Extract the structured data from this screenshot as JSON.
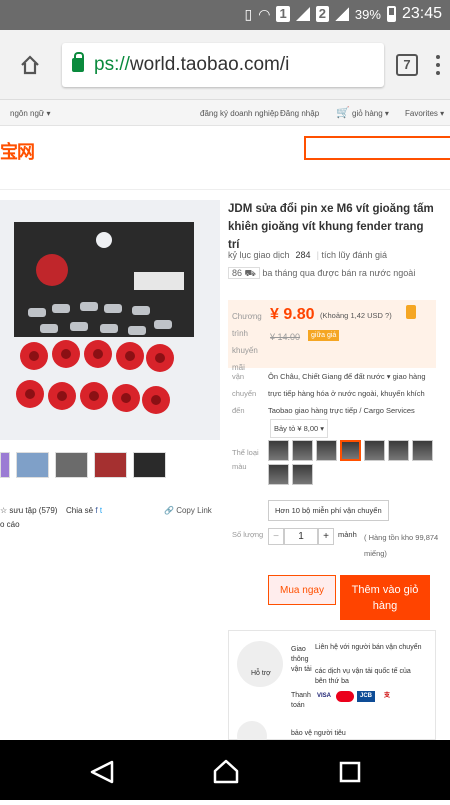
{
  "status": {
    "sim1": "1",
    "sim2": "2",
    "battery": "39%",
    "time": "23:45"
  },
  "browser": {
    "url_prefix": "ps://",
    "url_rest": "world.taobao.com/i",
    "tab_count": "7"
  },
  "topnav": {
    "language": "ngôn ngữ ▾",
    "business_signup": "đăng ký doanh nghiệp",
    "login": "Đăng nhập",
    "cart": "giỏ hàng ▾",
    "favorites": "Favorites ▾"
  },
  "logo": "宝网",
  "product": {
    "title": "JDM sửa đổi pin xe M6 vít gioăng tấm khiên gioăng vít khung fender trang trí",
    "record_label": "kỷ lục giao dịch",
    "record_count": "284",
    "reviews_label": "tích lũy đánh giá",
    "ship_count": "86",
    "ship_text": "ba tháng qua được bán ra nước ngoài",
    "price_label": "Chương trình khuyến mãi",
    "price": "¥ 9.80",
    "price_usd": "(Khoảng 1,42 USD ?)",
    "old_price": "¥ 14.00",
    "badge": "giữa giá",
    "ship_lbl": "vận chuyển đến",
    "ship_from": "Ôn Châu, Chiết Giang để  đất nước ▾  giao hàng trực tiếp hàng hóa ở nước ngoài, khuyến khích Taobao giao hàng trực tiếp / Cargo Services",
    "ship_fee": "Bảy tỏ ¥ 8,00 ▾",
    "variant_label": "Thể loại màu",
    "option": "Hơn 10 bộ miễn phí vận chuyển",
    "qty_label": "Số lượng",
    "qty": "1",
    "unit": "mảnh",
    "stock": "( Hàng tồn kho 99,874 miếng)",
    "buy": "Mua ngay",
    "add_cart": "Thêm vào giỏ hàng"
  },
  "left": {
    "fav": "sưu tập (579)",
    "share": "Chia sẻ",
    "copy": "Copy Link",
    "report": "o cáo"
  },
  "support": {
    "help": "Hỗ trợ",
    "service_lbl": "Giao thông vận tải",
    "service1": "Liên hệ với người bán vận chuyển",
    "service2": "các dịch vụ vận tải quốc tế của bên thứ ba",
    "pay_lbl": "Thanh toán",
    "more": "bảo vệ người tiêu"
  }
}
